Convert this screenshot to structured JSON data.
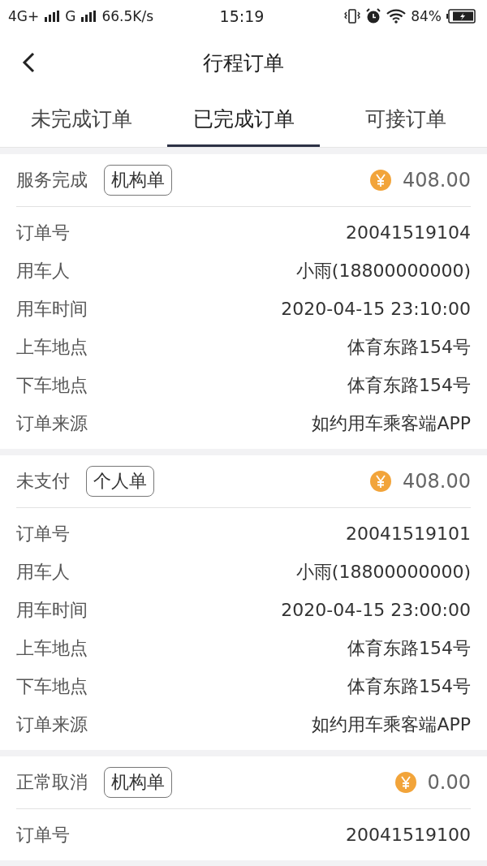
{
  "status_bar": {
    "network": "4G+",
    "network_2": "G",
    "speed": "66.5K/s",
    "time": "15:19",
    "battery": "84%"
  },
  "header": {
    "title": "行程订单"
  },
  "tabs": [
    {
      "label": "未完成订单",
      "selected": false
    },
    {
      "label": "已完成订单",
      "selected": true
    },
    {
      "label": "可接订单",
      "selected": false
    }
  ],
  "orders": [
    {
      "status": "服务完成",
      "type": "机构单",
      "amount": "408.00",
      "fields": [
        {
          "label": "订单号",
          "value": "20041519104"
        },
        {
          "label": "用车人",
          "value": "小雨(18800000000)"
        },
        {
          "label": "用车时间",
          "value": "2020-04-15 23:10:00"
        },
        {
          "label": "上车地点",
          "value": "体育东路154号"
        },
        {
          "label": "下车地点",
          "value": "体育东路154号"
        },
        {
          "label": "订单来源",
          "value": "如约用车乘客端APP"
        }
      ]
    },
    {
      "status": "未支付",
      "type": "个人单",
      "amount": "408.00",
      "fields": [
        {
          "label": "订单号",
          "value": "20041519101"
        },
        {
          "label": "用车人",
          "value": "小雨(18800000000)"
        },
        {
          "label": "用车时间",
          "value": "2020-04-15 23:00:00"
        },
        {
          "label": "上车地点",
          "value": "体育东路154号"
        },
        {
          "label": "下车地点",
          "value": "体育东路154号"
        },
        {
          "label": "订单来源",
          "value": "如约用车乘客端APP"
        }
      ]
    },
    {
      "status": "正常取消",
      "type": "机构单",
      "amount": "0.00",
      "fields": [
        {
          "label": "订单号",
          "value": "20041519100"
        }
      ]
    }
  ]
}
